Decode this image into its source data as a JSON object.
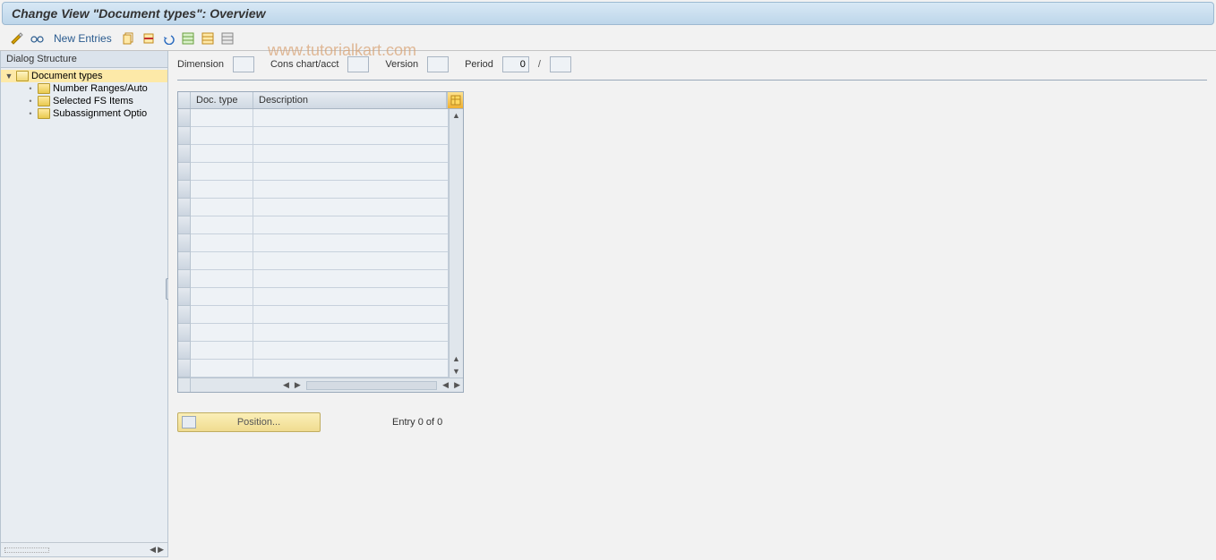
{
  "title": "Change View \"Document types\": Overview",
  "toolbar": {
    "new_entries_label": "New Entries"
  },
  "watermark": "www.tutorialkart.com",
  "sidebar": {
    "header": "Dialog Structure",
    "items": [
      {
        "label": "Document types",
        "selected": true,
        "expandable": true,
        "open": true,
        "level": 0
      },
      {
        "label": "Number Ranges/Auto",
        "selected": false,
        "expandable": false,
        "level": 1
      },
      {
        "label": "Selected FS Items",
        "selected": false,
        "expandable": false,
        "level": 1
      },
      {
        "label": "Subassignment Optio",
        "selected": false,
        "expandable": false,
        "level": 1
      }
    ]
  },
  "filters": {
    "dimension_label": "Dimension",
    "dimension_value": "",
    "conschart_label": "Cons chart/acct",
    "conschart_value": "",
    "version_label": "Version",
    "version_value": "",
    "period_label": "Period",
    "period_value1": "0",
    "period_value2": ""
  },
  "grid": {
    "col_doctype": "Doc. type",
    "col_description": "Description",
    "row_count": 15
  },
  "position_button_label": "Position...",
  "entry_status": "Entry 0 of 0"
}
